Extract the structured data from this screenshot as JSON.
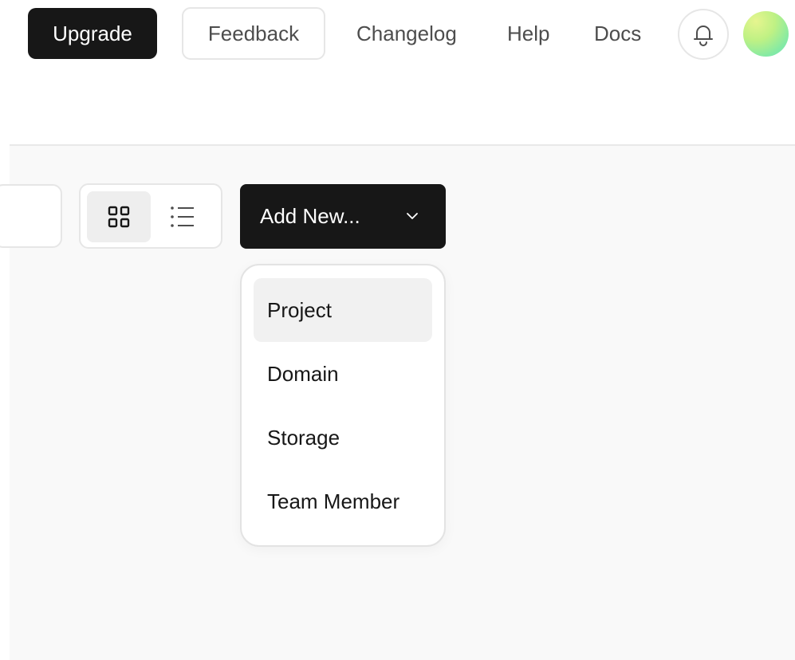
{
  "header": {
    "upgrade_label": "Upgrade",
    "feedback_label": "Feedback",
    "nav": [
      "Changelog",
      "Help",
      "Docs"
    ],
    "notification_icon": "bell-icon",
    "avatar_colors": [
      "#e6f58f",
      "#84eaa4",
      "#6de3c0"
    ]
  },
  "toolbar": {
    "view_options": [
      {
        "icon": "grid-icon",
        "selected": true
      },
      {
        "icon": "list-icon",
        "selected": false
      }
    ],
    "add_new_label": "Add New...",
    "add_new_icon": "chevron-down-icon"
  },
  "dropdown": {
    "items": [
      {
        "label": "Project",
        "highlighted": true
      },
      {
        "label": "Domain",
        "highlighted": false
      },
      {
        "label": "Storage",
        "highlighted": false
      },
      {
        "label": "Team Member",
        "highlighted": false
      }
    ]
  },
  "colors": {
    "primary_button": "#171717",
    "content_background": "#f9f9f9",
    "border": "#e6e6e6",
    "hover": "#f1f1f1"
  }
}
